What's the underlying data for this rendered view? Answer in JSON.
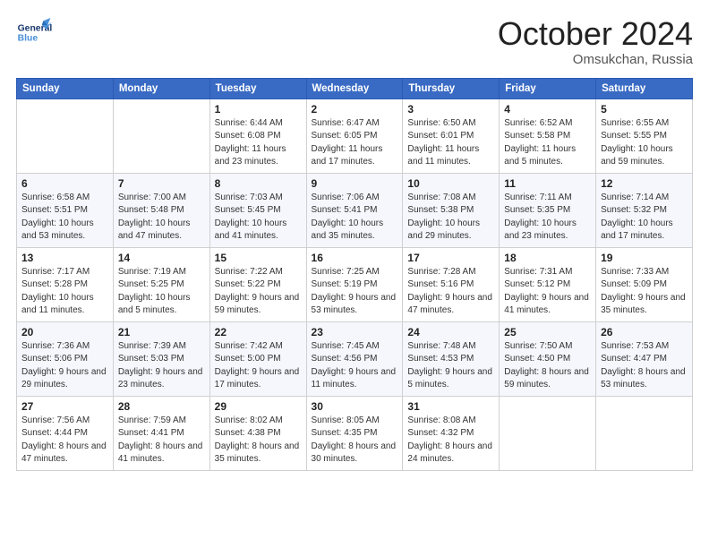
{
  "header": {
    "logo_general": "General",
    "logo_blue": "Blue",
    "month": "October 2024",
    "location": "Omsukchan, Russia"
  },
  "weekdays": [
    "Sunday",
    "Monday",
    "Tuesday",
    "Wednesday",
    "Thursday",
    "Friday",
    "Saturday"
  ],
  "weeks": [
    [
      {
        "day": "",
        "sunrise": "",
        "sunset": "",
        "daylight": ""
      },
      {
        "day": "",
        "sunrise": "",
        "sunset": "",
        "daylight": ""
      },
      {
        "day": "1",
        "sunrise": "Sunrise: 6:44 AM",
        "sunset": "Sunset: 6:08 PM",
        "daylight": "Daylight: 11 hours and 23 minutes."
      },
      {
        "day": "2",
        "sunrise": "Sunrise: 6:47 AM",
        "sunset": "Sunset: 6:05 PM",
        "daylight": "Daylight: 11 hours and 17 minutes."
      },
      {
        "day": "3",
        "sunrise": "Sunrise: 6:50 AM",
        "sunset": "Sunset: 6:01 PM",
        "daylight": "Daylight: 11 hours and 11 minutes."
      },
      {
        "day": "4",
        "sunrise": "Sunrise: 6:52 AM",
        "sunset": "Sunset: 5:58 PM",
        "daylight": "Daylight: 11 hours and 5 minutes."
      },
      {
        "day": "5",
        "sunrise": "Sunrise: 6:55 AM",
        "sunset": "Sunset: 5:55 PM",
        "daylight": "Daylight: 10 hours and 59 minutes."
      }
    ],
    [
      {
        "day": "6",
        "sunrise": "Sunrise: 6:58 AM",
        "sunset": "Sunset: 5:51 PM",
        "daylight": "Daylight: 10 hours and 53 minutes."
      },
      {
        "day": "7",
        "sunrise": "Sunrise: 7:00 AM",
        "sunset": "Sunset: 5:48 PM",
        "daylight": "Daylight: 10 hours and 47 minutes."
      },
      {
        "day": "8",
        "sunrise": "Sunrise: 7:03 AM",
        "sunset": "Sunset: 5:45 PM",
        "daylight": "Daylight: 10 hours and 41 minutes."
      },
      {
        "day": "9",
        "sunrise": "Sunrise: 7:06 AM",
        "sunset": "Sunset: 5:41 PM",
        "daylight": "Daylight: 10 hours and 35 minutes."
      },
      {
        "day": "10",
        "sunrise": "Sunrise: 7:08 AM",
        "sunset": "Sunset: 5:38 PM",
        "daylight": "Daylight: 10 hours and 29 minutes."
      },
      {
        "day": "11",
        "sunrise": "Sunrise: 7:11 AM",
        "sunset": "Sunset: 5:35 PM",
        "daylight": "Daylight: 10 hours and 23 minutes."
      },
      {
        "day": "12",
        "sunrise": "Sunrise: 7:14 AM",
        "sunset": "Sunset: 5:32 PM",
        "daylight": "Daylight: 10 hours and 17 minutes."
      }
    ],
    [
      {
        "day": "13",
        "sunrise": "Sunrise: 7:17 AM",
        "sunset": "Sunset: 5:28 PM",
        "daylight": "Daylight: 10 hours and 11 minutes."
      },
      {
        "day": "14",
        "sunrise": "Sunrise: 7:19 AM",
        "sunset": "Sunset: 5:25 PM",
        "daylight": "Daylight: 10 hours and 5 minutes."
      },
      {
        "day": "15",
        "sunrise": "Sunrise: 7:22 AM",
        "sunset": "Sunset: 5:22 PM",
        "daylight": "Daylight: 9 hours and 59 minutes."
      },
      {
        "day": "16",
        "sunrise": "Sunrise: 7:25 AM",
        "sunset": "Sunset: 5:19 PM",
        "daylight": "Daylight: 9 hours and 53 minutes."
      },
      {
        "day": "17",
        "sunrise": "Sunrise: 7:28 AM",
        "sunset": "Sunset: 5:16 PM",
        "daylight": "Daylight: 9 hours and 47 minutes."
      },
      {
        "day": "18",
        "sunrise": "Sunrise: 7:31 AM",
        "sunset": "Sunset: 5:12 PM",
        "daylight": "Daylight: 9 hours and 41 minutes."
      },
      {
        "day": "19",
        "sunrise": "Sunrise: 7:33 AM",
        "sunset": "Sunset: 5:09 PM",
        "daylight": "Daylight: 9 hours and 35 minutes."
      }
    ],
    [
      {
        "day": "20",
        "sunrise": "Sunrise: 7:36 AM",
        "sunset": "Sunset: 5:06 PM",
        "daylight": "Daylight: 9 hours and 29 minutes."
      },
      {
        "day": "21",
        "sunrise": "Sunrise: 7:39 AM",
        "sunset": "Sunset: 5:03 PM",
        "daylight": "Daylight: 9 hours and 23 minutes."
      },
      {
        "day": "22",
        "sunrise": "Sunrise: 7:42 AM",
        "sunset": "Sunset: 5:00 PM",
        "daylight": "Daylight: 9 hours and 17 minutes."
      },
      {
        "day": "23",
        "sunrise": "Sunrise: 7:45 AM",
        "sunset": "Sunset: 4:56 PM",
        "daylight": "Daylight: 9 hours and 11 minutes."
      },
      {
        "day": "24",
        "sunrise": "Sunrise: 7:48 AM",
        "sunset": "Sunset: 4:53 PM",
        "daylight": "Daylight: 9 hours and 5 minutes."
      },
      {
        "day": "25",
        "sunrise": "Sunrise: 7:50 AM",
        "sunset": "Sunset: 4:50 PM",
        "daylight": "Daylight: 8 hours and 59 minutes."
      },
      {
        "day": "26",
        "sunrise": "Sunrise: 7:53 AM",
        "sunset": "Sunset: 4:47 PM",
        "daylight": "Daylight: 8 hours and 53 minutes."
      }
    ],
    [
      {
        "day": "27",
        "sunrise": "Sunrise: 7:56 AM",
        "sunset": "Sunset: 4:44 PM",
        "daylight": "Daylight: 8 hours and 47 minutes."
      },
      {
        "day": "28",
        "sunrise": "Sunrise: 7:59 AM",
        "sunset": "Sunset: 4:41 PM",
        "daylight": "Daylight: 8 hours and 41 minutes."
      },
      {
        "day": "29",
        "sunrise": "Sunrise: 8:02 AM",
        "sunset": "Sunset: 4:38 PM",
        "daylight": "Daylight: 8 hours and 35 minutes."
      },
      {
        "day": "30",
        "sunrise": "Sunrise: 8:05 AM",
        "sunset": "Sunset: 4:35 PM",
        "daylight": "Daylight: 8 hours and 30 minutes."
      },
      {
        "day": "31",
        "sunrise": "Sunrise: 8:08 AM",
        "sunset": "Sunset: 4:32 PM",
        "daylight": "Daylight: 8 hours and 24 minutes."
      },
      {
        "day": "",
        "sunrise": "",
        "sunset": "",
        "daylight": ""
      },
      {
        "day": "",
        "sunrise": "",
        "sunset": "",
        "daylight": ""
      }
    ]
  ]
}
